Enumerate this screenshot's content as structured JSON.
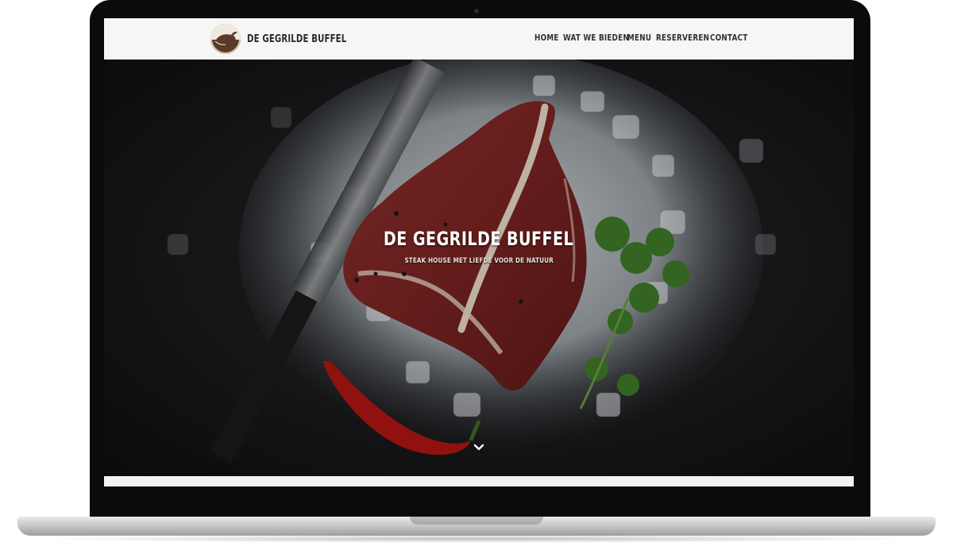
{
  "site": {
    "brand_name": "DE GEGRILDE BUFFEL",
    "logo_icon": "buffalo-logo-icon"
  },
  "nav": {
    "items": [
      {
        "label": "HOME"
      },
      {
        "label": "WAT WE BIEDEN"
      },
      {
        "label": "MENU"
      },
      {
        "label": "RESERVEREN"
      },
      {
        "label": "CONTACT"
      }
    ]
  },
  "hero": {
    "title": "DE GEGRILDE BUFFEL",
    "subtitle": "STEAK HOUSE MET LIEFDE VOOR DE NATUUR",
    "scroll_icon": "chevron-down-icon"
  },
  "colors": {
    "navbar_bg": "#f6f6f6",
    "nav_text": "#2f2f2f",
    "logo_bg": "#5b3b27",
    "hero_text": "#ffffff"
  }
}
